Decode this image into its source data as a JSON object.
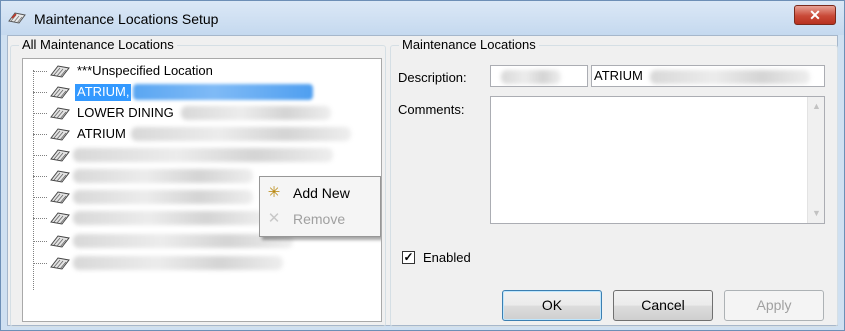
{
  "window": {
    "title": "Maintenance Locations Setup",
    "close_label": "✕"
  },
  "left_panel": {
    "legend": "All Maintenance Locations",
    "tree_items": [
      {
        "label": "***Unspecified Location",
        "selected": false
      },
      {
        "label": "ATRIUM,",
        "selected": true
      },
      {
        "label": "LOWER DINING",
        "selected": false
      },
      {
        "label": "ATRIUM",
        "selected": false
      },
      {
        "label": "",
        "selected": false
      },
      {
        "label": "",
        "selected": false
      },
      {
        "label": "",
        "selected": false
      },
      {
        "label": "",
        "selected": false
      },
      {
        "label": "",
        "selected": false
      },
      {
        "label": "",
        "selected": false
      }
    ]
  },
  "context_menu": {
    "add_new": "Add New",
    "remove": "Remove"
  },
  "right_panel": {
    "legend": "Maintenance Locations",
    "description_label": "Description:",
    "description_code_value": "",
    "description_value": "ATRIUM",
    "comments_label": "Comments:",
    "comments_value": "",
    "enabled_label": "Enabled",
    "enabled_checked": true
  },
  "buttons": {
    "ok": "OK",
    "cancel": "Cancel",
    "apply": "Apply"
  },
  "colors": {
    "selection": "#3399ff",
    "window_frame": "#cfe0f1"
  }
}
